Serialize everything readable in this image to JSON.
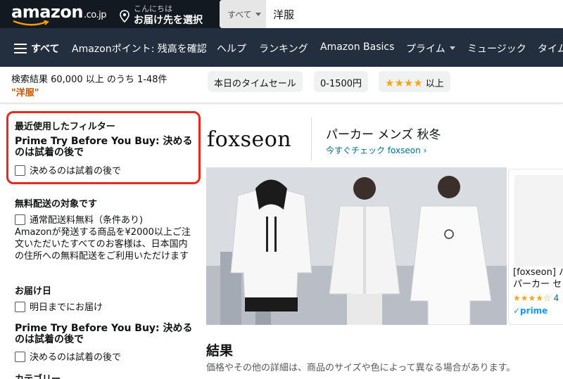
{
  "header": {
    "logo_text": "amazon",
    "logo_tld": ".co.jp",
    "deliver_line1": "こんにちは",
    "deliver_line2": "お届け先を選択",
    "search_category": "すべて",
    "search_value": "洋服"
  },
  "nav": {
    "all_label": "すべて",
    "items": [
      "Amazonポイント: 残高を確認",
      "ヘルプ",
      "ランキング",
      "Amazon Basics",
      "プライム",
      "ミュージック",
      "タイム"
    ]
  },
  "subbar": {
    "result_count": "検索結果 60,000 以上 のうち 1-48件",
    "query": "\"洋服\"",
    "chips": {
      "timesale": "本日のタイムセール",
      "price": "0-1500円",
      "stars": "★★★★",
      "stars_suffix": "以上"
    }
  },
  "sidebar": {
    "recent_heading": "最近使用したフィルター",
    "recent_sub": "Prime Try Before You Buy: 決めるのは試着の後で",
    "recent_option": "決めるのは試着の後で",
    "free_ship_heading": "無料配送の対象です",
    "free_ship_option": "通常配送料無料（条件あり)",
    "free_ship_desc": "Amazonが発送する商品を¥2000以上ご注文いただいたすべてのお客様は、日本国内の住所への無料配送をご利用いただけます",
    "delivery_heading": "お届け日",
    "delivery_option": "明日までにお届け",
    "try_heading": "Prime Try Before You Buy: 決めるのは試着の後で",
    "try_option": "決めるのは試着の後で",
    "category_heading": "カテゴリー"
  },
  "brand": {
    "logo": "foxseon",
    "title": "パーカー メンズ 秋冬",
    "link": "今すぐチェック foxseon ›"
  },
  "product_card": {
    "title1": "[foxseon] パ",
    "title2": "パーカー セ",
    "stars": "★★★★☆",
    "rating": "4",
    "prime": "✓prime"
  },
  "results": {
    "title": "結果",
    "subtitle": "価格やその他の詳細は、商品のサイズや色によって異なる場合があります。"
  },
  "colors": {
    "header_bg": "#131921",
    "nav_bg": "#232f3e",
    "accent_orange": "#c45500",
    "link_teal": "#007185",
    "highlight_red": "#e8291f",
    "star_gold": "#f8a51c"
  }
}
